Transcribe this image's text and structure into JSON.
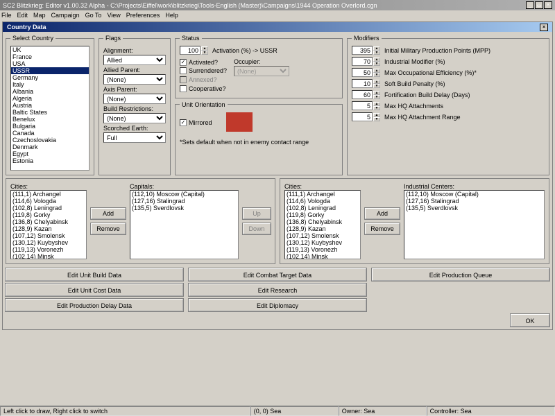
{
  "window_title": "SC2 Blitzkrieg: Editor v1.00.32 Alpha - C:\\Projects\\Eiffel\\work\\blitzkrieg\\Tools-English (Master)\\Campaigns\\1944 Operation Overlord.cgn",
  "menu": [
    "File",
    "Edit",
    "Map",
    "Campaign",
    "Go To",
    "View",
    "Preferences",
    "Help"
  ],
  "dialog_title": "Country Data",
  "select_country": {
    "legend": "Select Country",
    "items": [
      "UK",
      "France",
      "USA",
      "USSR",
      "Germany",
      "Italy",
      "Albania",
      "Algeria",
      "Austria",
      "Baltic States",
      "Benelux",
      "Bulgaria",
      "Canada",
      "Czechoslovakia",
      "Denmark",
      "Egypt",
      "Estonia"
    ],
    "selected": "USSR"
  },
  "flags": {
    "legend": "Flags",
    "alignment": {
      "label": "Alignment:",
      "value": "Allied"
    },
    "allied_parent": {
      "label": "Allied Parent:",
      "value": "(None)"
    },
    "axis_parent": {
      "label": "Axis Parent:",
      "value": "(None)"
    },
    "build_restrictions": {
      "label": "Build Restrictions:",
      "value": "(None)"
    },
    "scorched_earth": {
      "label": "Scorched Earth:",
      "value": "Full"
    }
  },
  "status": {
    "legend": "Status",
    "activation": {
      "value": "100",
      "label": "Activation (%) -> USSR"
    },
    "activated": "Activated?",
    "surrendered": "Surrendered?",
    "annexed": "Annexed?",
    "cooperative": "Cooperative?",
    "occupier": {
      "label": "Occupier:",
      "value": "(None)"
    }
  },
  "unit_orientation": {
    "legend": "Unit Orientation",
    "mirrored": "Mirrored",
    "note": "*Sets default when not in enemy contact range"
  },
  "modifiers": {
    "legend": "Modifiers",
    "mpp": {
      "value": "395",
      "label": "Initial Military Production Points (MPP)"
    },
    "ind": {
      "value": "70",
      "label": "Industrial Modifier (%)"
    },
    "occ": {
      "value": "50",
      "label": "Max Occupational Efficiency (%)*"
    },
    "soft": {
      "value": "10",
      "label": "Soft Build Penalty (%)"
    },
    "fort": {
      "value": "60",
      "label": "Fortification Build Delay (Days)"
    },
    "hq": {
      "value": "5",
      "label": "Max HQ Attachments"
    },
    "hqr": {
      "value": "5",
      "label": "Max HQ Attachment Range"
    }
  },
  "cities_left": {
    "label": "Cities:",
    "items": [
      "(111,1) Archangel",
      "(114,6) Vologda",
      "(102,8) Leningrad",
      "(119,8) Gorky",
      "(136,8) Chelyabinsk",
      "(128,9) Kazan",
      "(107,12) Smolensk",
      "(130,12) Kuybyshev",
      "(119,13) Voronezh",
      "(102,14) Minsk"
    ]
  },
  "capitals": {
    "label": "Capitals:",
    "items": [
      "(112,10) Moscow (Capital)",
      "(127,16) Stalingrad",
      "(135,5) Sverdlovsk"
    ]
  },
  "cities_right": {
    "label": "Cities:",
    "items": [
      "(111,1) Archangel",
      "(114,6) Vologda",
      "(102,8) Leningrad",
      "(119,8) Gorky",
      "(136,8) Chelyabinsk",
      "(128,9) Kazan",
      "(107,12) Smolensk",
      "(130,12) Kuybyshev",
      "(119,13) Voronezh",
      "(102,14) Minsk"
    ]
  },
  "industrial": {
    "label": "Industrial Centers:",
    "items": [
      "(112,10) Moscow (Capital)",
      "(127,16) Stalingrad",
      "(135,5) Sverdlovsk"
    ]
  },
  "buttons": {
    "add": "Add",
    "remove": "Remove",
    "up": "Up",
    "down": "Down",
    "b1": "Edit Unit Build Data",
    "b2": "Edit Unit Cost Data",
    "b3": "Edit Production Delay Data",
    "b4": "Edit Combat Target Data",
    "b5": "Edit Research",
    "b6": "Edit Diplomacy",
    "b7": "Edit Production Queue",
    "ok": "OK"
  },
  "statusbar": {
    "s1": "Left click to draw, Right click to switch",
    "s2": "(0, 0) Sea",
    "s3": "Owner:  Sea",
    "s4": "Controller:  Sea"
  }
}
